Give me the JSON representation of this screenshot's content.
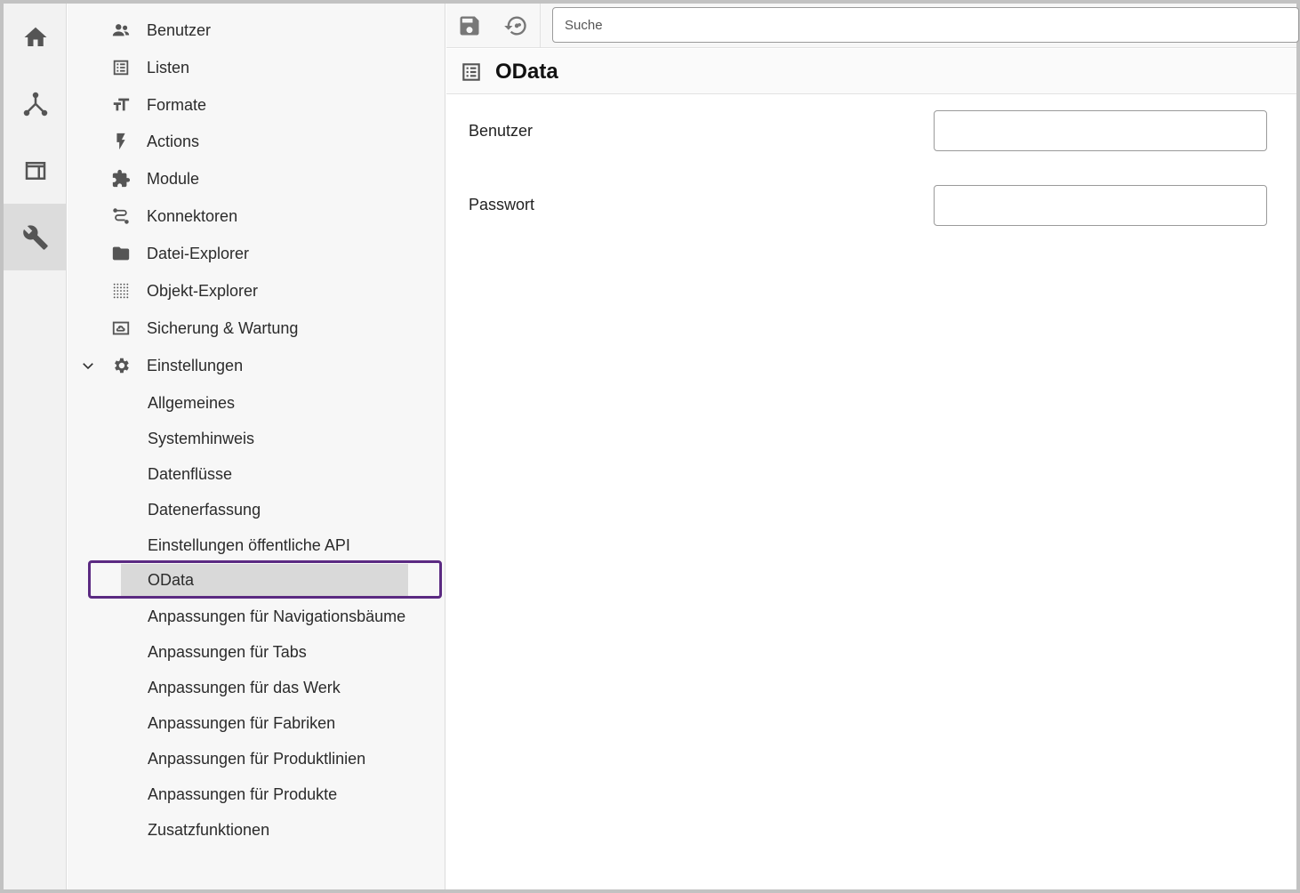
{
  "rail": {
    "items": [
      {
        "name": "home-icon"
      },
      {
        "name": "hierarchy-icon"
      },
      {
        "name": "layout-icon"
      },
      {
        "name": "wrench-icon",
        "active": true
      }
    ]
  },
  "nav": {
    "items": [
      {
        "label": "Benutzer",
        "icon": "users-icon"
      },
      {
        "label": "Listen",
        "icon": "list-icon"
      },
      {
        "label": "Formate",
        "icon": "text-format-icon"
      },
      {
        "label": "Actions",
        "icon": "bolt-icon"
      },
      {
        "label": "Module",
        "icon": "puzzle-icon"
      },
      {
        "label": "Konnektoren",
        "icon": "connector-icon"
      },
      {
        "label": "Datei-Explorer",
        "icon": "folder-icon"
      },
      {
        "label": "Objekt-Explorer",
        "icon": "dot-grid-icon"
      },
      {
        "label": "Sicherung & Wartung",
        "icon": "backup-icon"
      },
      {
        "label": "Einstellungen",
        "icon": "gear-icon",
        "expanded": true
      }
    ],
    "sub_items": [
      {
        "label": "Allgemeines"
      },
      {
        "label": "Systemhinweis"
      },
      {
        "label": "Datenflüsse"
      },
      {
        "label": "Datenerfassung"
      },
      {
        "label": "Einstellungen öffentliche API"
      },
      {
        "label": "OData",
        "selected": true
      },
      {
        "label": "Anpassungen für Navigationsbäume"
      },
      {
        "label": "Anpassungen für Tabs"
      },
      {
        "label": "Anpassungen für das Werk"
      },
      {
        "label": "Anpassungen für Fabriken"
      },
      {
        "label": "Anpassungen für Produktlinien"
      },
      {
        "label": "Anpassungen für Produkte"
      },
      {
        "label": "Zusatzfunktionen"
      }
    ]
  },
  "toolbar": {
    "save_icon": "save-icon",
    "history_icon": "history-icon",
    "search_placeholder": "Suche"
  },
  "page": {
    "title": "OData",
    "fields": [
      {
        "label": "Benutzer",
        "value": ""
      },
      {
        "label": "Passwort",
        "value": ""
      }
    ]
  },
  "colors": {
    "selection_outline": "#5b2a82",
    "selected_bg": "#d9d9d9",
    "rail_active_bg": "#dcdcdc"
  }
}
